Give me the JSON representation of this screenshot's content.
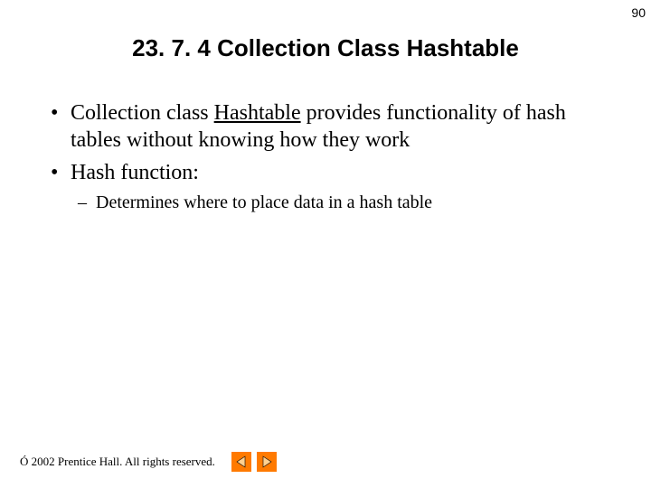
{
  "page_number": "90",
  "title": "23. 7. 4 Collection Class Hashtable",
  "bullets": {
    "b1_pre": "Collection class ",
    "b1_underlined": "Hashtable",
    "b1_post": " provides functionality of hash tables without knowing how they work",
    "b2": "Hash function:",
    "b2_sub": "Determines where to place data in a hash table"
  },
  "footer": {
    "copyright": "Ó 2002 Prentice Hall. All rights reserved.",
    "nav_prev": "previous-slide",
    "nav_next": "next-slide"
  }
}
